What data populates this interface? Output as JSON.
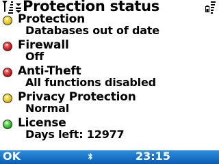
{
  "titlebar": {
    "title": "Protection status",
    "icons": [
      "signal-icon",
      "network-icon",
      "battery-icon"
    ]
  },
  "status_items": [
    {
      "name": "Protection",
      "value": "Databases out of date",
      "status_color": "#e8c61c",
      "icon": "yellow-status-icon"
    },
    {
      "name": "Firewall",
      "value": "Off",
      "status_color": "#d61c1c",
      "icon": "red-status-icon"
    },
    {
      "name": "Anti-Theft",
      "value": "All functions disabled",
      "status_color": "#d61c1c",
      "icon": "red-status-icon"
    },
    {
      "name": "Privacy Protection",
      "value": "Normal",
      "status_color": "#e8c61c",
      "icon": "yellow-status-icon"
    },
    {
      "name": "License",
      "value": "Days left: 12977",
      "status_color": "#2fbf2a",
      "icon": "green-status-icon"
    }
  ],
  "softkeys": {
    "left_label": "OK",
    "clock": "23:15",
    "bluetooth_icon": "bluetooth-icon"
  },
  "colors": {
    "softkey_bar": "#0a5cb4",
    "background": "#ffffff"
  }
}
